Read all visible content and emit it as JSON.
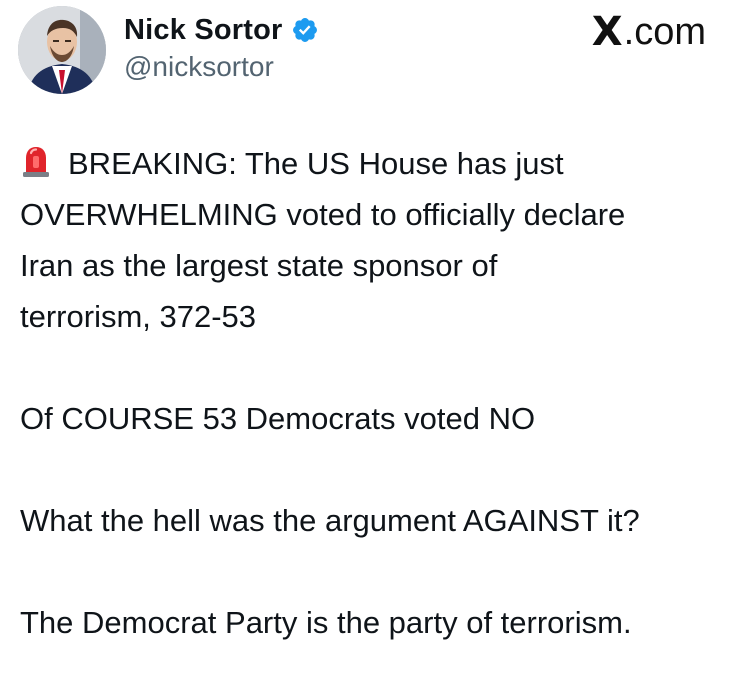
{
  "author": {
    "display_name": "Nick Sortor",
    "handle": "@nicksortor",
    "verified_icon": "verified-badge-icon",
    "verified_color": "#1d9bf0",
    "avatar": "profile-photo"
  },
  "site": {
    "label": ".com",
    "logo_glyph": "X",
    "full_label": "X.com"
  },
  "tweet": {
    "lead_icon": "police-siren-icon",
    "lines": [
      "BREAKING: The US House has just",
      "OVERWHELMING voted to officially declare",
      "Iran as the largest state sponsor of",
      "terrorism, 372-53",
      "Of COURSE 53 Democrats voted NO",
      "What the hell was the argument AGAINST it?",
      "The Democrat Party is the party of terrorism."
    ]
  },
  "colors": {
    "text": "#0f1419",
    "secondary": "#536471",
    "background": "#ffffff",
    "siren_red": "#e0242b"
  }
}
